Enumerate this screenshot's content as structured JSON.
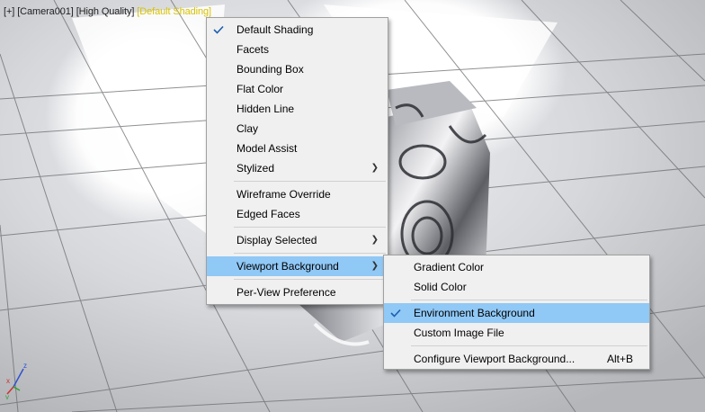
{
  "viewport_label": {
    "plus": "[+]",
    "camera": "[Camera001]",
    "quality": "[High Quality]",
    "shading": "[Default Shading]",
    "active_color": "#d8c200"
  },
  "shading_menu": {
    "items": [
      {
        "label": "Default Shading",
        "checked": true
      },
      {
        "label": "Facets"
      },
      {
        "label": "Bounding Box"
      },
      {
        "label": "Flat Color"
      },
      {
        "label": "Hidden Line"
      },
      {
        "label": "Clay"
      },
      {
        "label": "Model Assist"
      },
      {
        "label": "Stylized",
        "submenu": true
      },
      {
        "label": "Wireframe Override"
      },
      {
        "label": "Edged Faces"
      },
      {
        "label": "Display Selected",
        "submenu": true
      },
      {
        "label": "Viewport Background",
        "submenu": true,
        "highlighted": true
      },
      {
        "label": "Per-View Preference"
      }
    ]
  },
  "background_submenu": {
    "items": [
      {
        "label": "Gradient Color"
      },
      {
        "label": "Solid Color"
      },
      {
        "label": "Environment Background",
        "checked": true,
        "highlighted": true
      },
      {
        "label": "Custom Image File"
      },
      {
        "label": "Configure Viewport Background...",
        "shortcut": "Alt+B"
      }
    ]
  },
  "axis_gizmo": {
    "x": "x",
    "y": "y",
    "z": "z"
  },
  "icons": {
    "check": "checkmark-icon",
    "submenu": "chevron-right-icon"
  },
  "colors": {
    "highlight": "#90c8f6",
    "menu_bg": "#f0f0f0",
    "axis_x": "#d03030",
    "axis_y": "#30a030",
    "axis_z": "#3050d0"
  }
}
